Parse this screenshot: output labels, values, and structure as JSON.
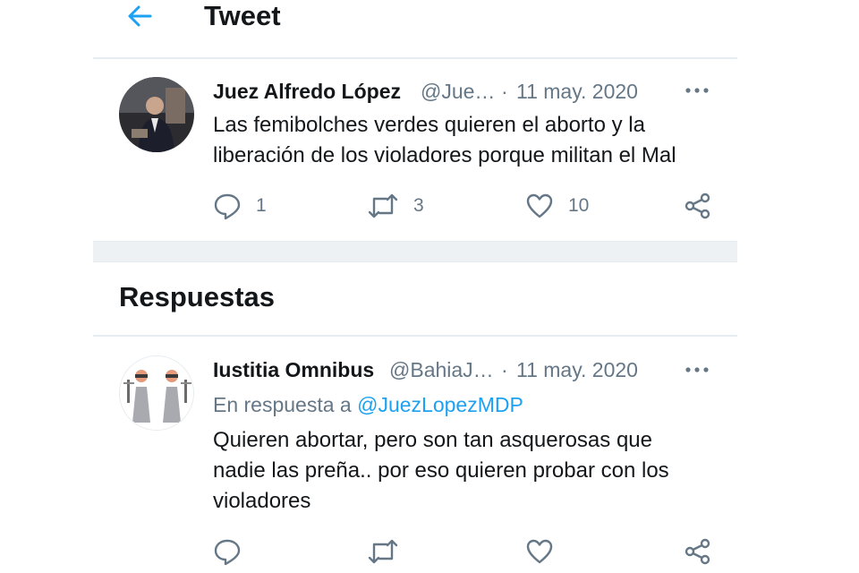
{
  "header": {
    "title": "Tweet"
  },
  "tweet": {
    "author_name": "Juez Alfredo López",
    "author_handle": "@Jue…",
    "separator": "·",
    "date": "11 may. 2020",
    "text_line1": "Las femibolches verdes quieren el aborto y la",
    "text_line2": "liberación de los violadores porque militan el Mal",
    "replies": "1",
    "retweets": "3",
    "likes": "10"
  },
  "replies_section": {
    "title": "Respuestas"
  },
  "reply": {
    "author_name": "Iustitia Omnibus",
    "author_handle": "@BahiaJ…",
    "separator": "·",
    "date": "11 may. 2020",
    "reply_prefix": "En respuesta a",
    "reply_to_handle": "@JuezLopezMDP",
    "text_line1": "Quieren abortar, pero son tan asquerosas que",
    "text_line2": "nadie las preña.. por eso quieren probar con los",
    "text_line3": "violadores"
  },
  "colors": {
    "accent": "#1da1f2",
    "secondary_text": "#657786",
    "divider": "#e6ecf0"
  },
  "icons": [
    "back-arrow-icon",
    "more-icon",
    "reply-icon",
    "retweet-icon",
    "like-icon",
    "share-icon"
  ]
}
